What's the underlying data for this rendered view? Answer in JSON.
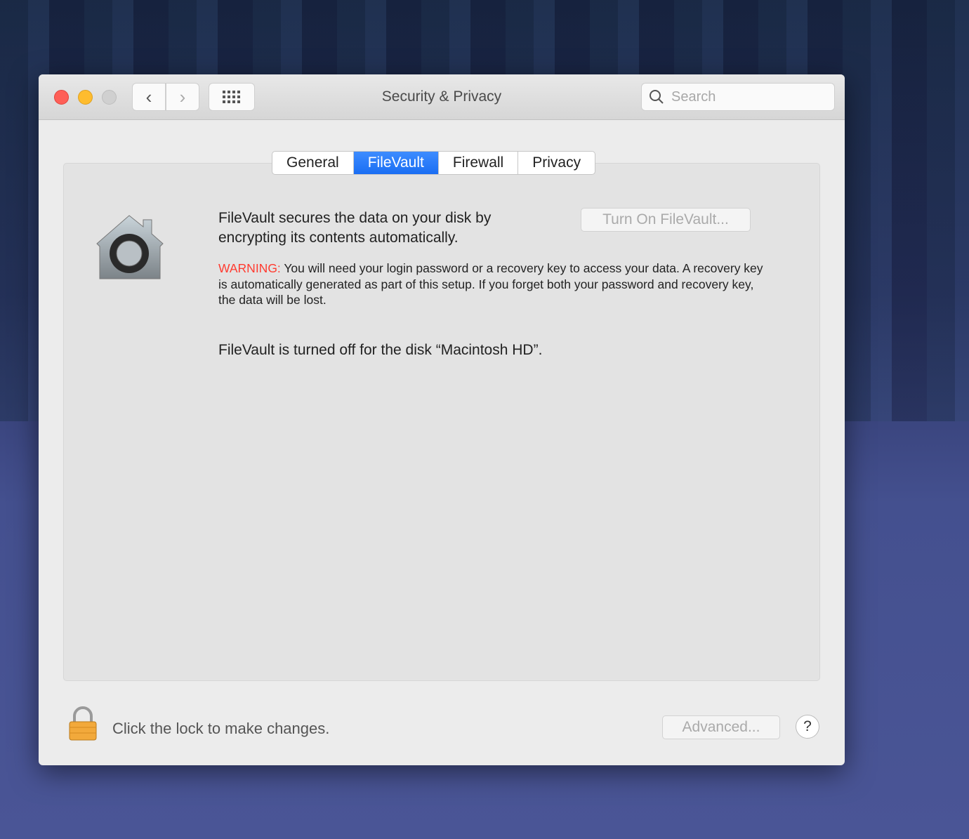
{
  "window": {
    "title": "Security & Privacy"
  },
  "search": {
    "placeholder": "Search"
  },
  "tabs": [
    {
      "label": "General"
    },
    {
      "label": "FileVault",
      "active": true
    },
    {
      "label": "Firewall"
    },
    {
      "label": "Privacy"
    }
  ],
  "filevault": {
    "description": "FileVault secures the data on your disk by encrypting its contents automatically.",
    "turn_on_label": "Turn On FileVault...",
    "warning_label": "WARNING:",
    "warning_text": " You will need your login password or a recovery key to access your data. A recovery key is automatically generated as part of this setup. If you forget both your password and recovery key, the data will be lost.",
    "status": "FileVault is turned off for the disk “Macintosh HD”."
  },
  "footer": {
    "lock_text": "Click the lock to make changes.",
    "advanced_label": "Advanced...",
    "help_label": "?"
  },
  "colors": {
    "accent": "#1a6ef3",
    "warning": "#ff3b30",
    "close": "#fe5f57",
    "minimize": "#febc2e",
    "zoom": "#d0d0d0"
  }
}
